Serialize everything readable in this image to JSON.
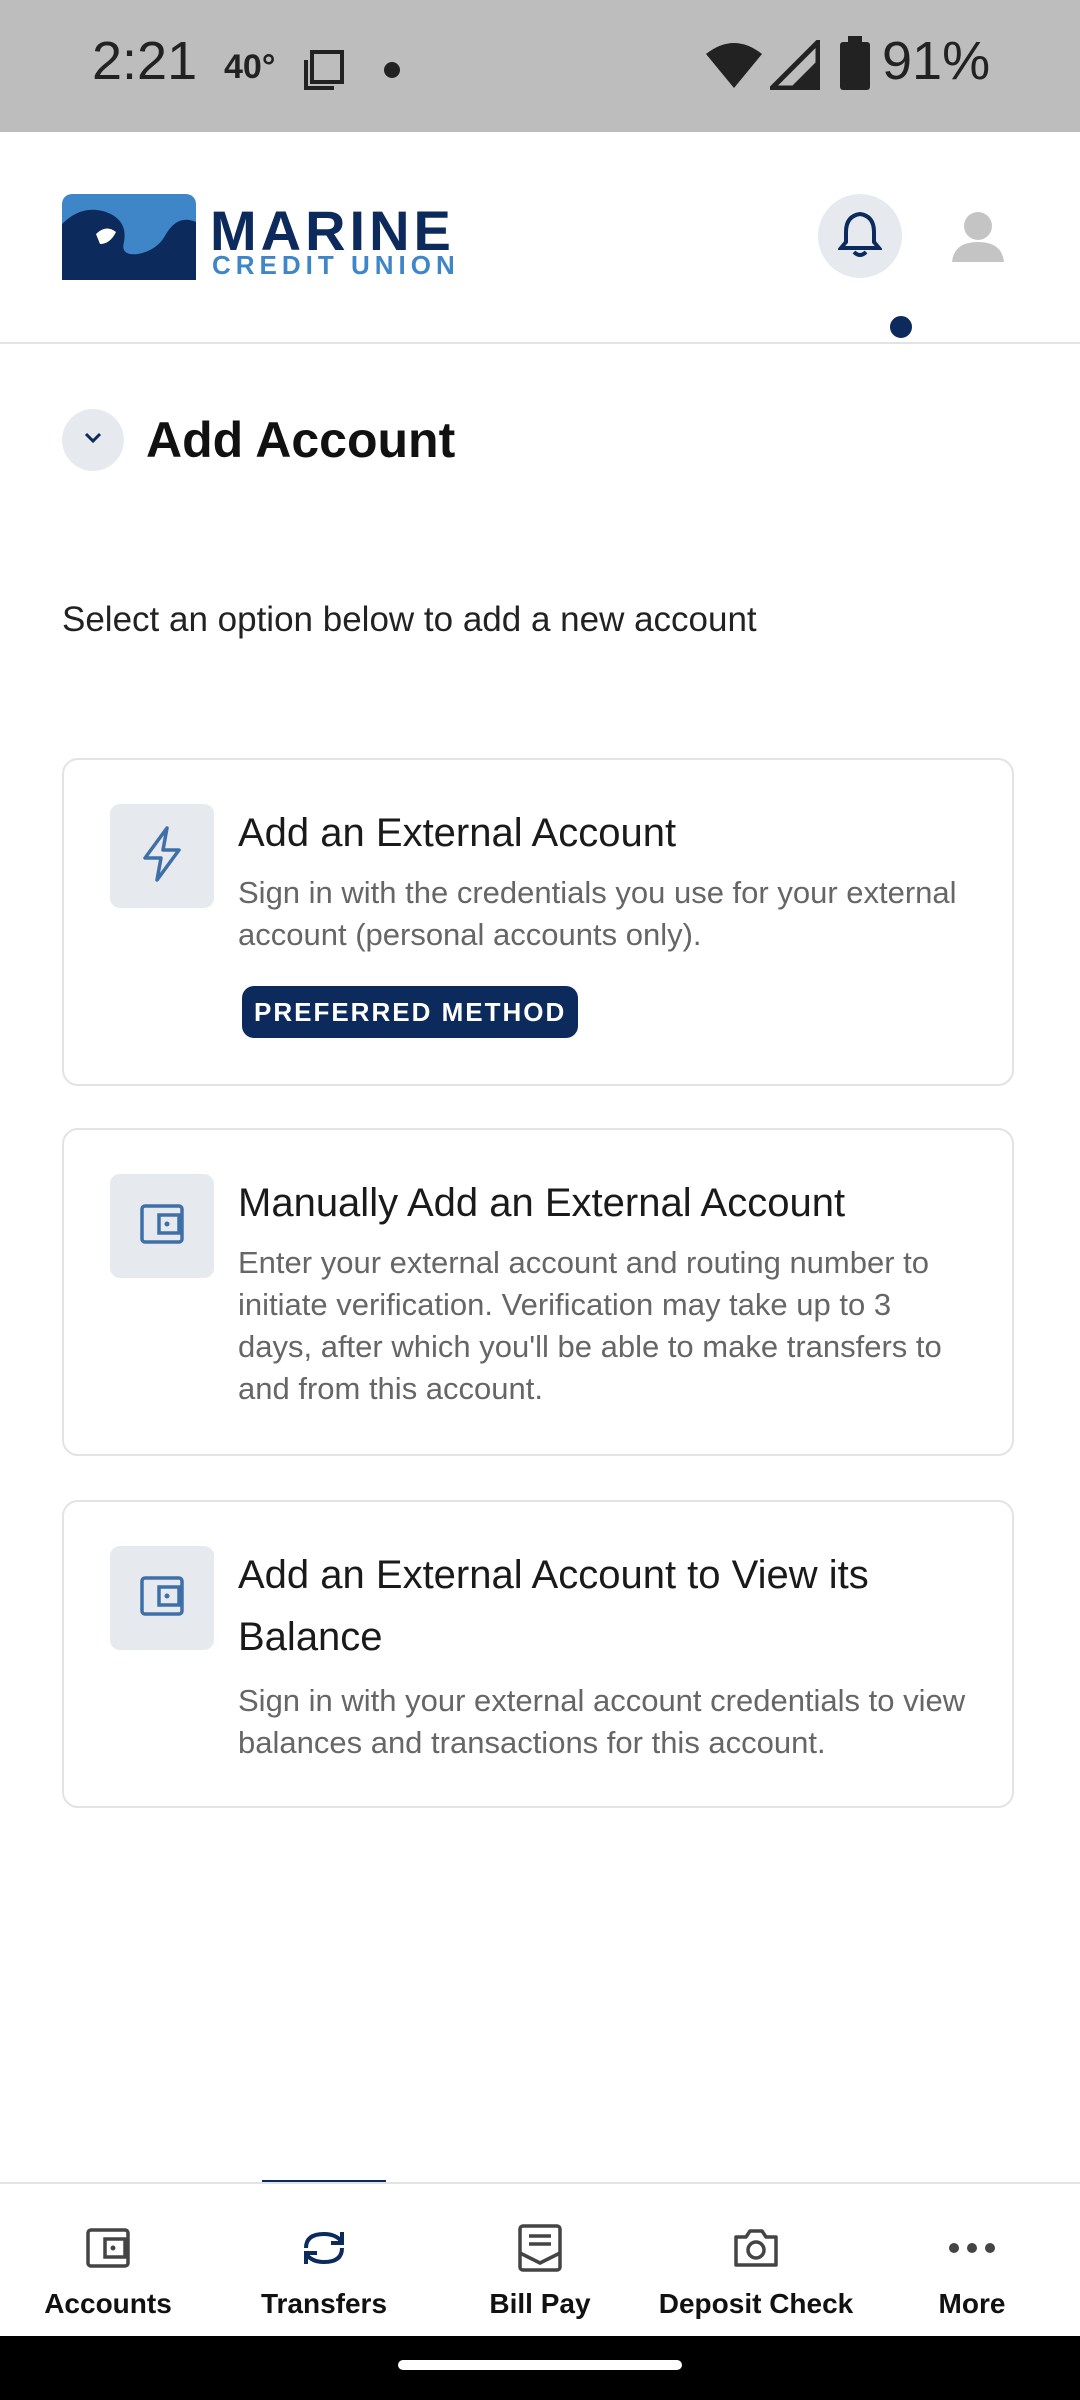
{
  "status_bar": {
    "time": "2:21",
    "temperature": "40°",
    "battery": "91%"
  },
  "header": {
    "logo_line1": "MARINE",
    "logo_line2": "CREDIT UNION",
    "notification_dot": true
  },
  "page": {
    "title": "Add Account",
    "subtitle": "Select an option below to add a new account"
  },
  "options": [
    {
      "icon": "lightning-icon",
      "title": "Add an External Account",
      "description": "Sign in with the credentials you use for your external account (personal accounts only).",
      "badge": "PREFERRED METHOD"
    },
    {
      "icon": "wallet-icon",
      "title": "Manually Add an External Account",
      "description": "Enter your external account and routing number to initiate verification. Verification may take up to 3 days, after which you'll be able to make transfers to and from this account."
    },
    {
      "icon": "wallet-icon",
      "title": "Add an External Account to View its Balance",
      "description": "Sign in with your external account credentials to view balances and transactions for this account."
    }
  ],
  "bottom_nav": {
    "active": "Transfers",
    "items": [
      {
        "label": "Accounts",
        "icon": "wallet-icon"
      },
      {
        "label": "Transfers",
        "icon": "transfer-arrows-icon"
      },
      {
        "label": "Bill Pay",
        "icon": "bill-icon"
      },
      {
        "label": "Deposit Check",
        "icon": "camera-icon"
      },
      {
        "label": "More",
        "icon": "more-dots-icon"
      }
    ]
  },
  "colors": {
    "brand_navy": "#0d2a5c",
    "brand_blue": "#3f86c9",
    "icon_bg": "#e6eaee"
  }
}
